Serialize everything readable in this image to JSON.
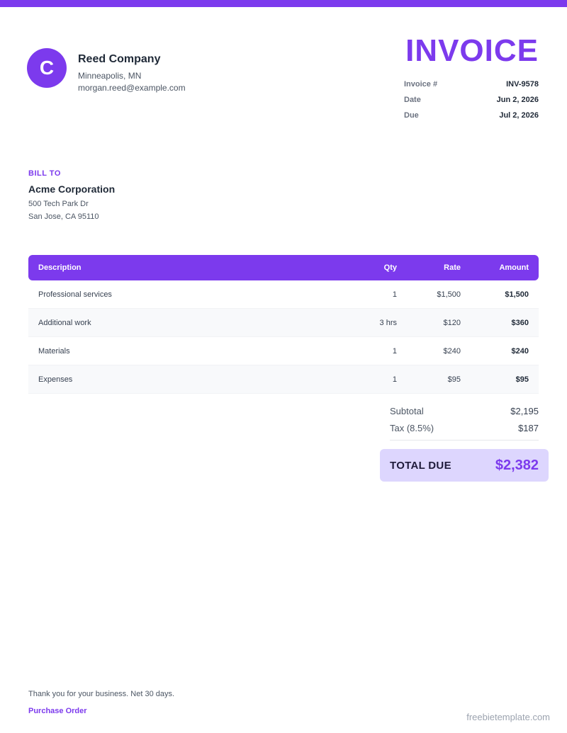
{
  "brand": {
    "accent": "#7c3aed",
    "accent_light": "#ddd6fe"
  },
  "company": {
    "logo_letter": "C",
    "name": "Reed Company",
    "location": "Minneapolis, MN",
    "email": "morgan.reed@example.com"
  },
  "invoice": {
    "title": "INVOICE",
    "meta": [
      {
        "label": "Invoice #",
        "value": "INV-9578"
      },
      {
        "label": "Date",
        "value": "Jun 2, 2026"
      },
      {
        "label": "Due",
        "value": "Jul 2, 2026"
      }
    ]
  },
  "bill_to": {
    "label": "BILL TO",
    "name": "Acme Corporation",
    "address_line1": "500 Tech Park Dr",
    "address_line2": "San Jose, CA 95110"
  },
  "table": {
    "headers": {
      "description": "Description",
      "qty": "Qty",
      "rate": "Rate",
      "amount": "Amount"
    },
    "rows": [
      {
        "description": "Professional services",
        "qty": "1",
        "rate": "$1,500",
        "amount": "$1,500"
      },
      {
        "description": "Additional work",
        "qty": "3 hrs",
        "rate": "$120",
        "amount": "$360"
      },
      {
        "description": "Materials",
        "qty": "1",
        "rate": "$240",
        "amount": "$240"
      },
      {
        "description": "Expenses",
        "qty": "1",
        "rate": "$95",
        "amount": "$95"
      }
    ]
  },
  "totals": {
    "subtotal_label": "Subtotal",
    "subtotal_value": "$2,195",
    "tax_label": "Tax (8.5%)",
    "tax_value": "$187",
    "total_label": "TOTAL DUE",
    "total_value": "$2,382"
  },
  "footer": {
    "note": "Thank you for your business. Net 30 days.",
    "link": "Purchase Order",
    "watermark": "freebietemplate.com"
  }
}
